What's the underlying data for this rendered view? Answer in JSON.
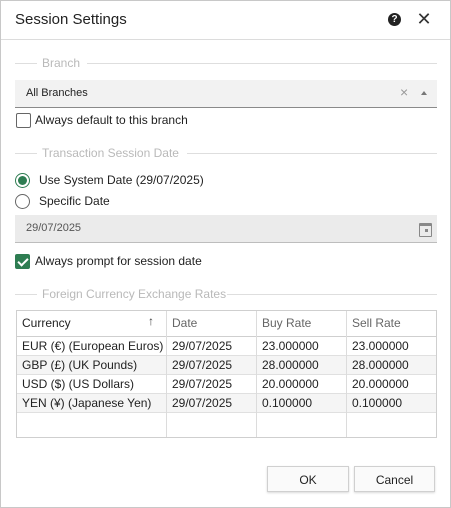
{
  "dialog": {
    "title": "Session Settings"
  },
  "branch": {
    "section_label": "Branch",
    "selected": "All Branches",
    "clear_glyph": "×",
    "default_checkbox_label": "Always default to this branch",
    "default_checked": false
  },
  "session_date": {
    "section_label": "Transaction Session Date",
    "system_date_label": "Use System Date (29/07/2025)",
    "specific_date_label": "Specific Date",
    "selected_option": "system",
    "date_value": "29/07/2025",
    "prompt_checkbox_label": "Always prompt for session date",
    "prompt_checked": true
  },
  "rates": {
    "section_label": "Foreign Currency Exchange Rates",
    "sort_glyph": "↑",
    "columns": [
      "Currency",
      "Date",
      "Buy Rate",
      "Sell Rate"
    ],
    "rows": [
      [
        "EUR (€) (European Euros)",
        "29/07/2025",
        "23.000000",
        "23.000000"
      ],
      [
        "GBP (£) (UK Pounds)",
        "29/07/2025",
        "28.000000",
        "28.000000"
      ],
      [
        "USD ($) (US Dollars)",
        "29/07/2025",
        "20.000000",
        "20.000000"
      ],
      [
        "YEN (¥) (Japanese Yen)",
        "29/07/2025",
        "0.100000",
        "0.100000"
      ]
    ]
  },
  "buttons": {
    "ok": "OK",
    "cancel": "Cancel"
  },
  "colors": {
    "accent": "#2e7d52",
    "section_label": "#b9b9b9",
    "input_bg": "#f2f2f2"
  }
}
